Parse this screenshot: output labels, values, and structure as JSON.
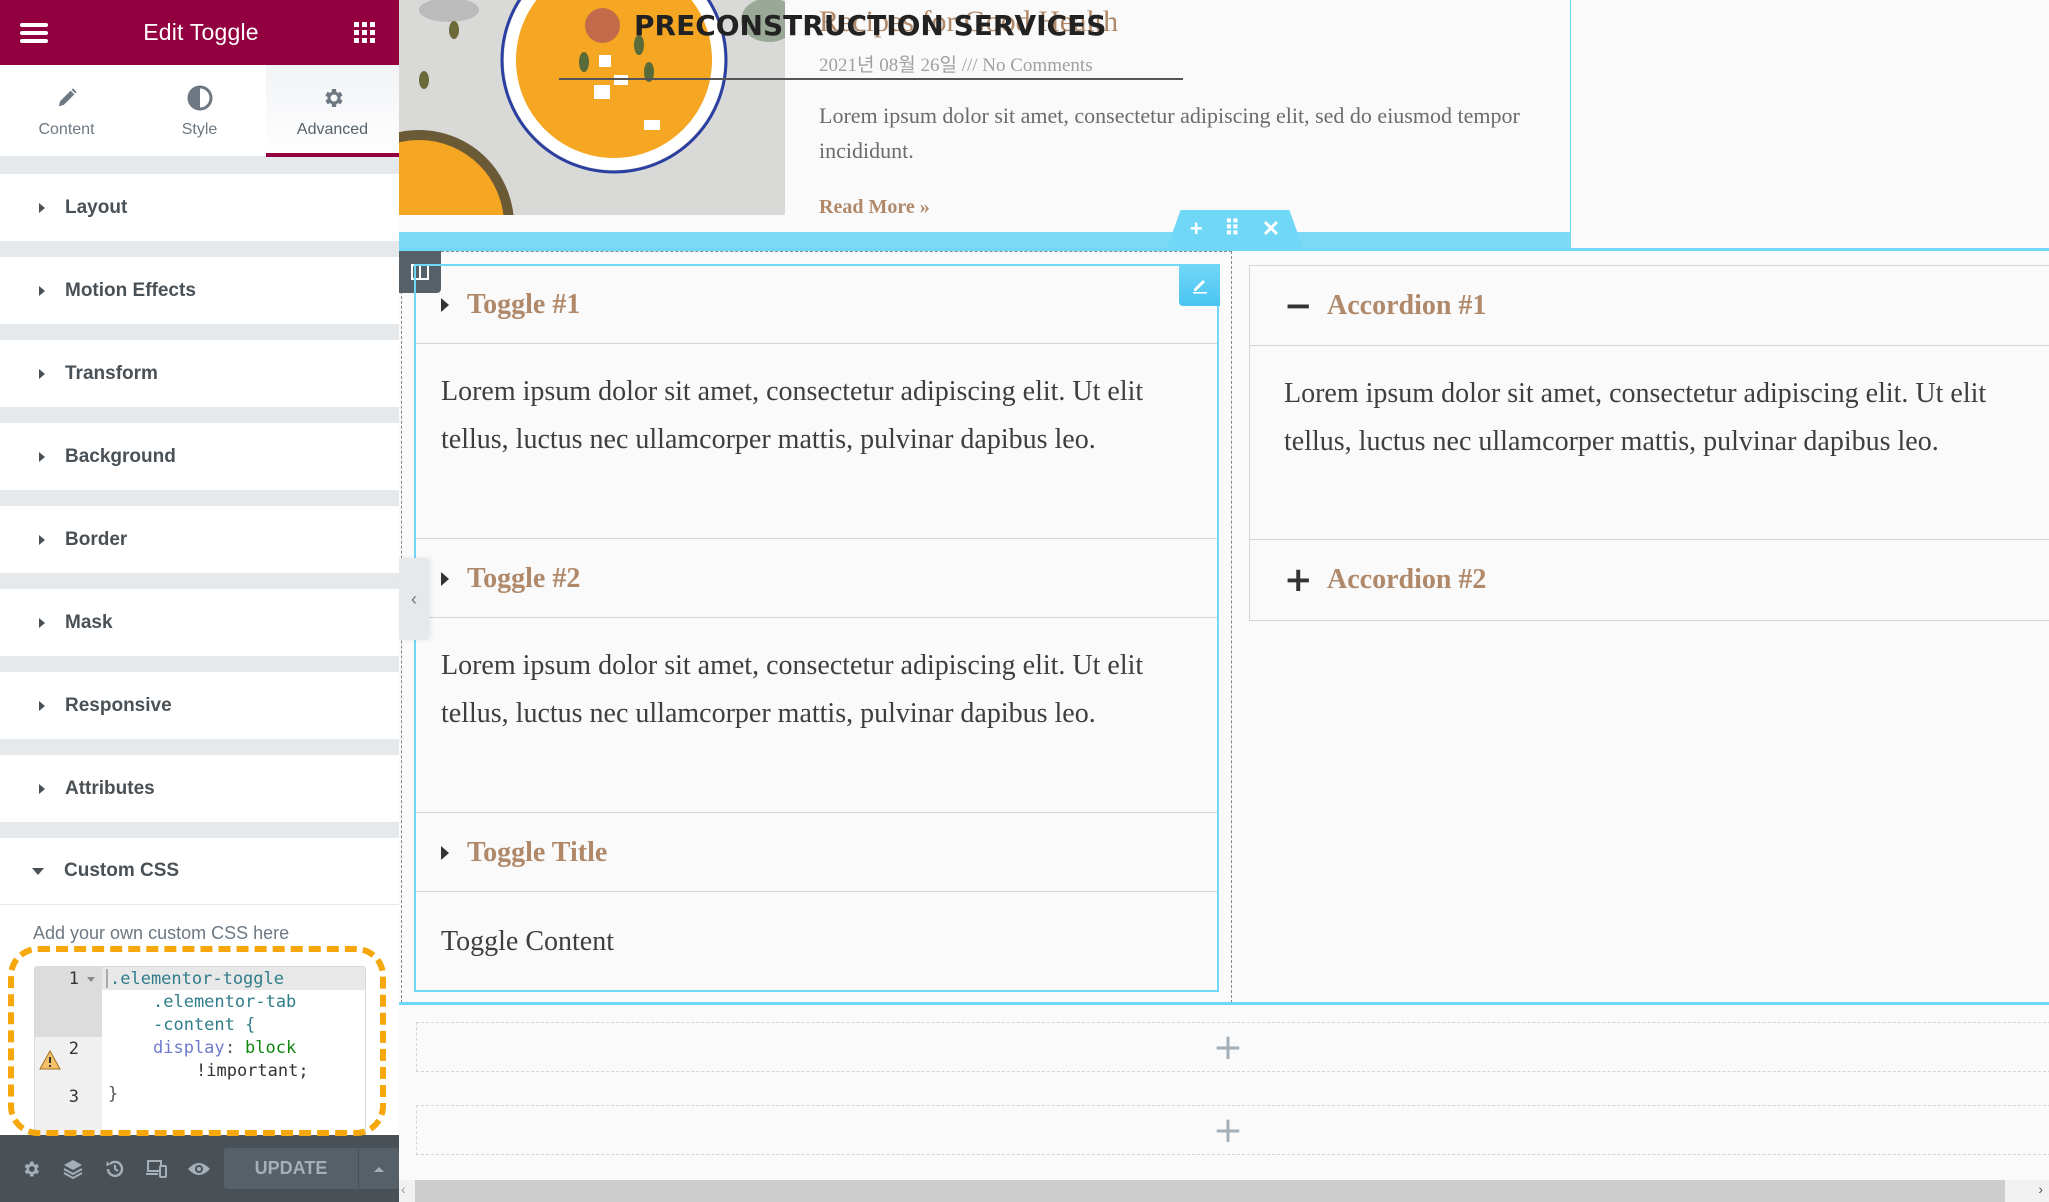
{
  "panel": {
    "title": "Edit Toggle",
    "tabs": [
      {
        "label": "Content",
        "icon": "pencil-icon",
        "active": false
      },
      {
        "label": "Style",
        "icon": "half-circle-icon",
        "active": false
      },
      {
        "label": "Advanced",
        "icon": "gear-icon",
        "active": true
      }
    ],
    "sections": [
      {
        "label": "Layout",
        "open": false
      },
      {
        "label": "Motion Effects",
        "open": false
      },
      {
        "label": "Transform",
        "open": false
      },
      {
        "label": "Background",
        "open": false
      },
      {
        "label": "Border",
        "open": false
      },
      {
        "label": "Mask",
        "open": false
      },
      {
        "label": "Responsive",
        "open": false
      },
      {
        "label": "Attributes",
        "open": false
      },
      {
        "label": "Custom CSS",
        "open": true
      }
    ],
    "custom_css": {
      "hint": "Add your own custom CSS here",
      "line_numbers": [
        "1",
        "2",
        "3"
      ],
      "code": {
        "line1_selector_a": ".elementor-toggle",
        "line1_selector_b": ".elementor-tab",
        "line1_selector_c": "-content {",
        "line2_property": "display",
        "line2_colon": ":",
        "line2_value": "block",
        "line2_important": "!important;",
        "line3": "}"
      },
      "warning_line": "2"
    },
    "footer": {
      "icons": [
        "settings-icon",
        "layers-icon",
        "history-icon",
        "responsive-icon",
        "preview-eye-icon"
      ],
      "update_label": "UPDATE"
    }
  },
  "preview": {
    "header": {
      "brand": "PRECONSTRUCTION SERVICES"
    },
    "post": {
      "title": "Recipes for Good Health",
      "meta": "2021년 08월 26일 /// No Comments",
      "excerpt": "Lorem ipsum dolor sit amet, consectetur adipiscing elit, sed do eiusmod tempor incididunt.",
      "read_more": "Read More »"
    },
    "section_handle": {
      "add": "+",
      "move": "⠿",
      "delete": "✕"
    },
    "toggle": {
      "items": [
        {
          "title": "Toggle #1",
          "content": "Lorem ipsum dolor sit amet, consectetur adipiscing elit. Ut elit tellus, luctus nec ullamcorper mattis, pulvinar dapibus leo."
        },
        {
          "title": "Toggle #2",
          "content": "Lorem ipsum dolor sit amet, consectetur adipiscing elit. Ut elit tellus, luctus nec ullamcorper mattis, pulvinar dapibus leo."
        },
        {
          "title": "Toggle Title",
          "content": "Toggle Content"
        }
      ]
    },
    "accordion": {
      "items": [
        {
          "title": "Accordion #1",
          "sign": "−",
          "open": true,
          "content": "Lorem ipsum dolor sit amet, consectetur adipiscing elit. Ut elit tellus, luctus nec ullamcorper mattis, pulvinar dapibus leo."
        },
        {
          "title": "Accordion #2",
          "sign": "+",
          "open": false
        }
      ]
    },
    "add_section_label": "+"
  },
  "colors": {
    "brand": "#93003f",
    "accent_blue": "#71d7f7",
    "title_tan": "#b0896a",
    "highlight_orange": "#f5a70c"
  }
}
